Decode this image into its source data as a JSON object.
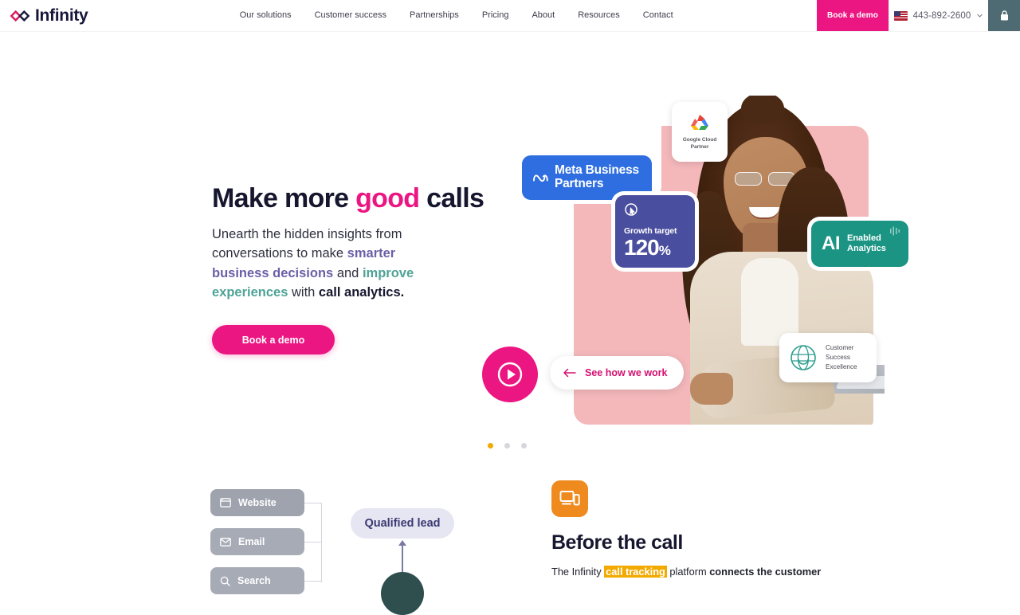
{
  "header": {
    "brand": "Infinity",
    "brand_icon": "infinity-logo-icon",
    "nav": [
      {
        "label": "Our solutions"
      },
      {
        "label": "Customer success"
      },
      {
        "label": "Partnerships"
      },
      {
        "label": "Pricing"
      },
      {
        "label": "About"
      },
      {
        "label": "Resources"
      },
      {
        "label": "Contact"
      }
    ],
    "demo_button": "Book a demo",
    "phone": "443-892-2600",
    "flag_icon": "us-flag-icon",
    "chevron_icon": "chevron-down-icon",
    "lock_icon": "lock-icon"
  },
  "hero": {
    "headline_pre": "Make more ",
    "headline_accent": "good",
    "headline_post": " calls",
    "sub_1": "Unearth the hidden insights from conversations to make ",
    "sub_purple": "smarter business decisions",
    "sub_2": " and ",
    "sub_teal": "improve experiences",
    "sub_3": " with ",
    "sub_bold": "call analytics.",
    "cta": "Book a demo",
    "see_how": "See how we work",
    "play_icon": "play-button-icon",
    "arrow_icon": "arrow-left-icon"
  },
  "badges": {
    "meta": {
      "text_line1": "Meta Business",
      "text_line2": "Partners",
      "icon": "meta-infinity-icon",
      "color": "#2e6ee0"
    },
    "google_cloud": {
      "line1": "Google Cloud",
      "line2": "Partner",
      "icon": "google-cloud-icon"
    },
    "growth": {
      "label": "Growth target",
      "value": "120",
      "unit": "%",
      "icon": "target-cursor-icon",
      "color": "#4a4e9e"
    },
    "ai": {
      "big": "AI",
      "line1": "Enabled",
      "line2": "Analytics",
      "icon": "waveform-icon",
      "color": "#1c9484"
    },
    "cse": {
      "line1": "Customer",
      "line2": "Success",
      "line3": "Excellence",
      "icon": "globe-ribbon-icon"
    }
  },
  "carousel": {
    "dots": [
      {
        "active": true,
        "color": "#f2a900"
      },
      {
        "active": false,
        "color": "#d6d6dc"
      },
      {
        "active": false,
        "color": "#d6d6dc"
      }
    ]
  },
  "flow": {
    "chips": [
      {
        "label": "Website",
        "icon": "browser-window-icon"
      },
      {
        "label": "Email",
        "icon": "envelope-icon"
      },
      {
        "label": "Search",
        "icon": "magnifier-icon"
      }
    ],
    "qualified_lead": "Qualified lead"
  },
  "before_section": {
    "icon": "devices-icon",
    "title": "Before the call",
    "body_pre": "The Infinity ",
    "body_highlight": "call tracking",
    "body_mid": " platform ",
    "body_bold": "connects the customer",
    "body_post": ""
  }
}
